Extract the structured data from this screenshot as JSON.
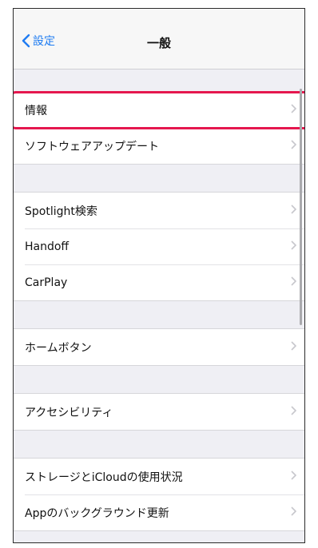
{
  "nav": {
    "back_label": "設定",
    "title": "一般"
  },
  "sections": [
    {
      "items": [
        {
          "label": "情報"
        },
        {
          "label": "ソフトウェアアップデート"
        }
      ]
    },
    {
      "items": [
        {
          "label": "Spotlight検索"
        },
        {
          "label": "Handoff"
        },
        {
          "label": "CarPlay"
        }
      ]
    },
    {
      "items": [
        {
          "label": "ホームボタン"
        }
      ]
    },
    {
      "items": [
        {
          "label": "アクセシビリティ"
        }
      ]
    },
    {
      "items": [
        {
          "label": "ストレージとiCloudの使用状況"
        },
        {
          "label": "Appのバックグラウンド更新"
        }
      ]
    }
  ],
  "colors": {
    "accent": "#1f7cf2",
    "highlight": "#e5174e",
    "grouped_background": "#efeff4"
  },
  "icons": {
    "back": "chevron-left-icon",
    "disclosure": "chevron-right-icon"
  }
}
